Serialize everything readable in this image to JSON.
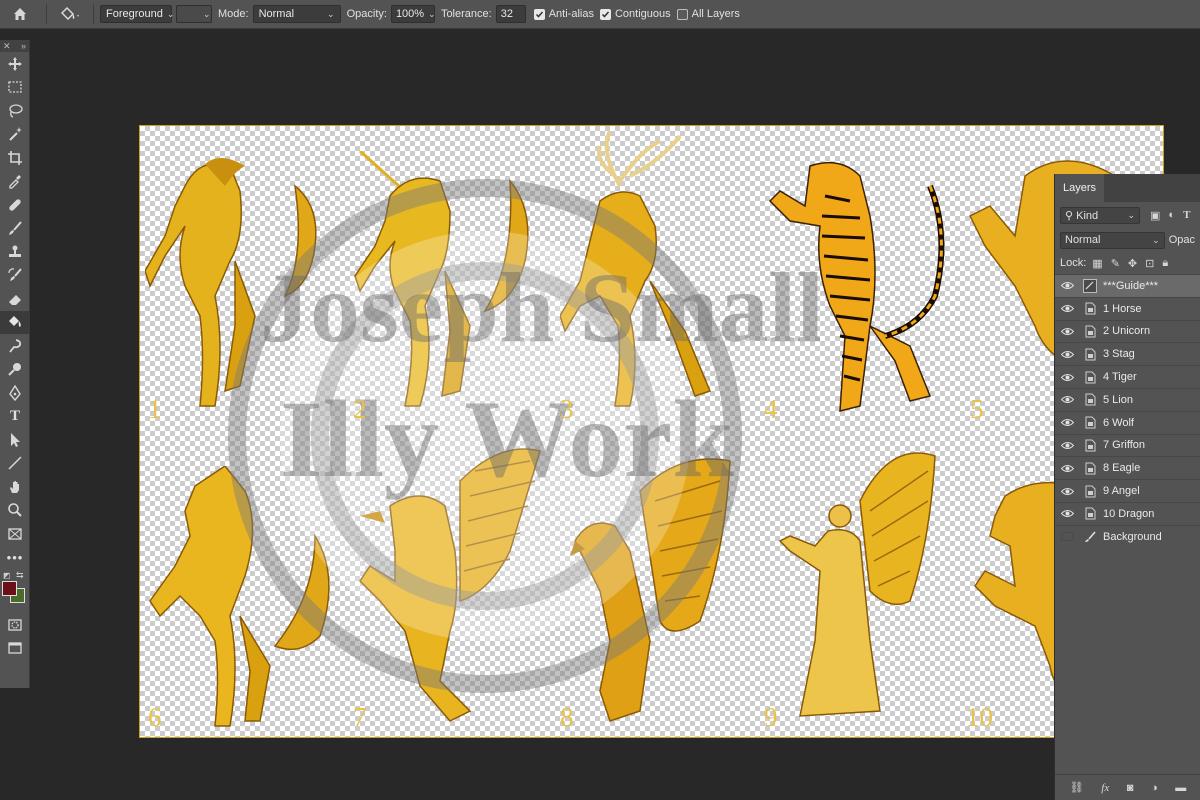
{
  "options_bar": {
    "fill_source": "Foreground",
    "mode_label": "Mode:",
    "mode_value": "Normal",
    "opacity_label": "Opacity:",
    "opacity_value": "100%",
    "tolerance_label": "Tolerance:",
    "tolerance_value": "32",
    "anti_alias_label": "Anti-alias",
    "anti_alias_checked": true,
    "contiguous_label": "Contiguous",
    "contiguous_checked": true,
    "all_layers_label": "All Layers",
    "all_layers_checked": false
  },
  "toolbar": {
    "active_tool": "paint-bucket",
    "foreground_color": "#6b0f1a",
    "background_color": "#4a6b2a"
  },
  "canvas": {
    "labels": [
      "1",
      "2",
      "3",
      "4",
      "5",
      "6",
      "7",
      "8",
      "9",
      "10"
    ],
    "accent_color": "#e8b820"
  },
  "layers_panel": {
    "tab_title": "Layers",
    "filter_kind": "Kind",
    "blend_mode": "Normal",
    "opacity_partial": "Opac",
    "lock_label": "Lock:",
    "layers": [
      {
        "name": "***Guide***",
        "visible": true,
        "selected": true
      },
      {
        "name": "1 Horse",
        "visible": true,
        "selected": false
      },
      {
        "name": "2 Unicorn",
        "visible": true,
        "selected": false
      },
      {
        "name": "3 Stag",
        "visible": true,
        "selected": false
      },
      {
        "name": "4 Tiger",
        "visible": true,
        "selected": false
      },
      {
        "name": "5 Lion",
        "visible": true,
        "selected": false
      },
      {
        "name": "6 Wolf",
        "visible": true,
        "selected": false
      },
      {
        "name": "7 Griffon",
        "visible": true,
        "selected": false
      },
      {
        "name": "8 Eagle",
        "visible": true,
        "selected": false
      },
      {
        "name": "9 Angel",
        "visible": true,
        "selected": false
      },
      {
        "name": "10 Dragon",
        "visible": true,
        "selected": false
      },
      {
        "name": "Background",
        "visible": false,
        "selected": false
      }
    ]
  }
}
